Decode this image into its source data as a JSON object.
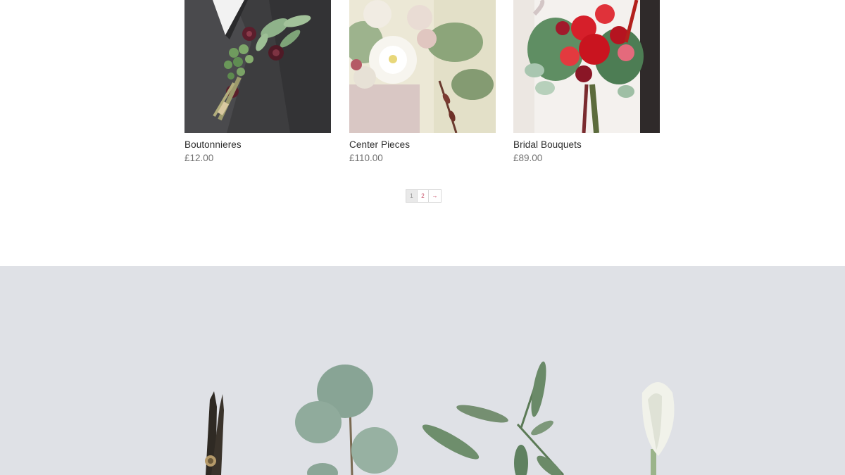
{
  "products": [
    {
      "name": "Boutonnieres",
      "price": "£12.00",
      "image": "boutonniere-photo"
    },
    {
      "name": "Center Pieces",
      "price": "£110.00",
      "image": "centerpiece-photo"
    },
    {
      "name": "Bridal Bouquets",
      "price": "£89.00",
      "image": "bridal-bouquet-photo"
    }
  ],
  "pagination": {
    "pages": [
      "1",
      "2"
    ],
    "current": "1",
    "next_label": "→"
  },
  "hero": {
    "image": "flatlay-scissors-eucalyptus-calla-lily-photo",
    "background": "#dfe1e6"
  },
  "colors": {
    "link_accent": "#c2405a",
    "product_name": "#2b2b2b",
    "price": "#6f6f6f"
  }
}
